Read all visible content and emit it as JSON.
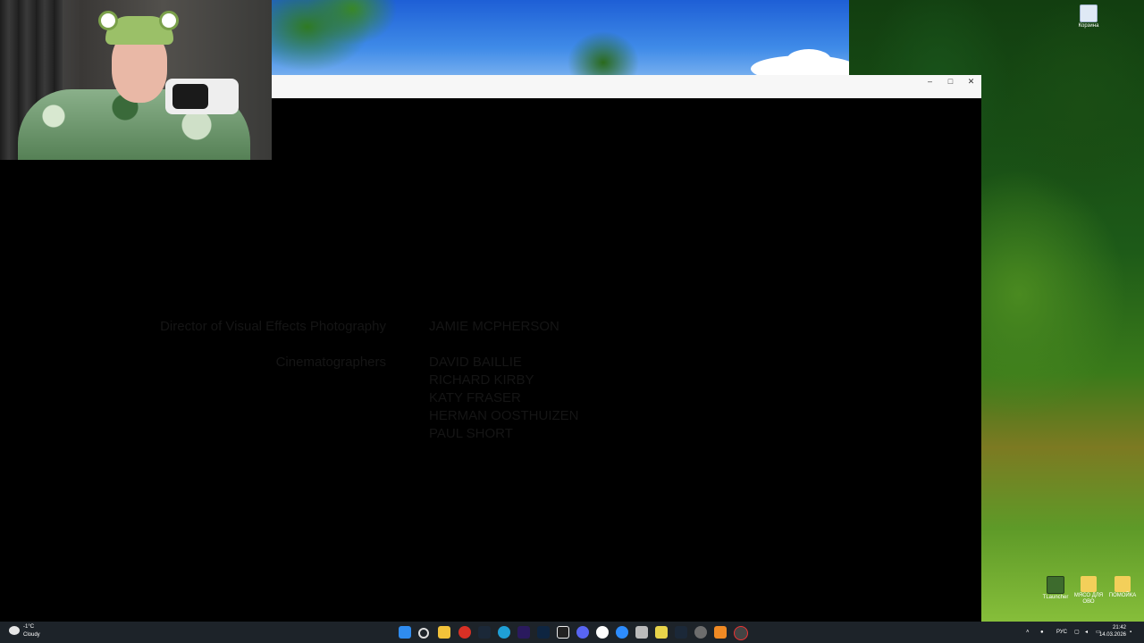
{
  "desktop": {
    "icons": [
      {
        "label": "Корзина",
        "icon": "recycle-bin-icon"
      },
      {
        "label": "TLauncher",
        "icon": "minecraft-launcher-icon"
      },
      {
        "label": "МЯСО ДЛЯ ОВО",
        "icon": "folder-icon"
      },
      {
        "label": "ПОМОЙКА",
        "icon": "folder-icon"
      }
    ]
  },
  "window": {
    "controls": {
      "minimize": "–",
      "maximize": "□",
      "close": "✕"
    }
  },
  "credits": {
    "role1": "Director of Visual Effects Photography",
    "name1": "JAMIE MCPHERSON",
    "role2": "Cinematographers",
    "names2": [
      "DAVID BAILLIE",
      "RICHARD KIRBY",
      "KATY FRASER",
      "HERMAN OOSTHUIZEN",
      "PAUL SHORT"
    ]
  },
  "taskbar": {
    "weather": {
      "temp": "-1°C",
      "condition": "Cloudy"
    },
    "apps": [
      "start-icon",
      "search-icon",
      "file-explorer-icon",
      "chrome-icon",
      "steam-icon",
      "edge-icon",
      "premiere-icon",
      "photoshop-icon",
      "capcut-icon",
      "discord-icon",
      "yandex-icon",
      "zoom-icon",
      "app-icon",
      "app-icon",
      "steam-icon",
      "settings-icon",
      "vlc-icon",
      "obs-icon"
    ],
    "tray": {
      "lang": "РУС",
      "time": "21:42",
      "date": "14.03.2026"
    }
  }
}
